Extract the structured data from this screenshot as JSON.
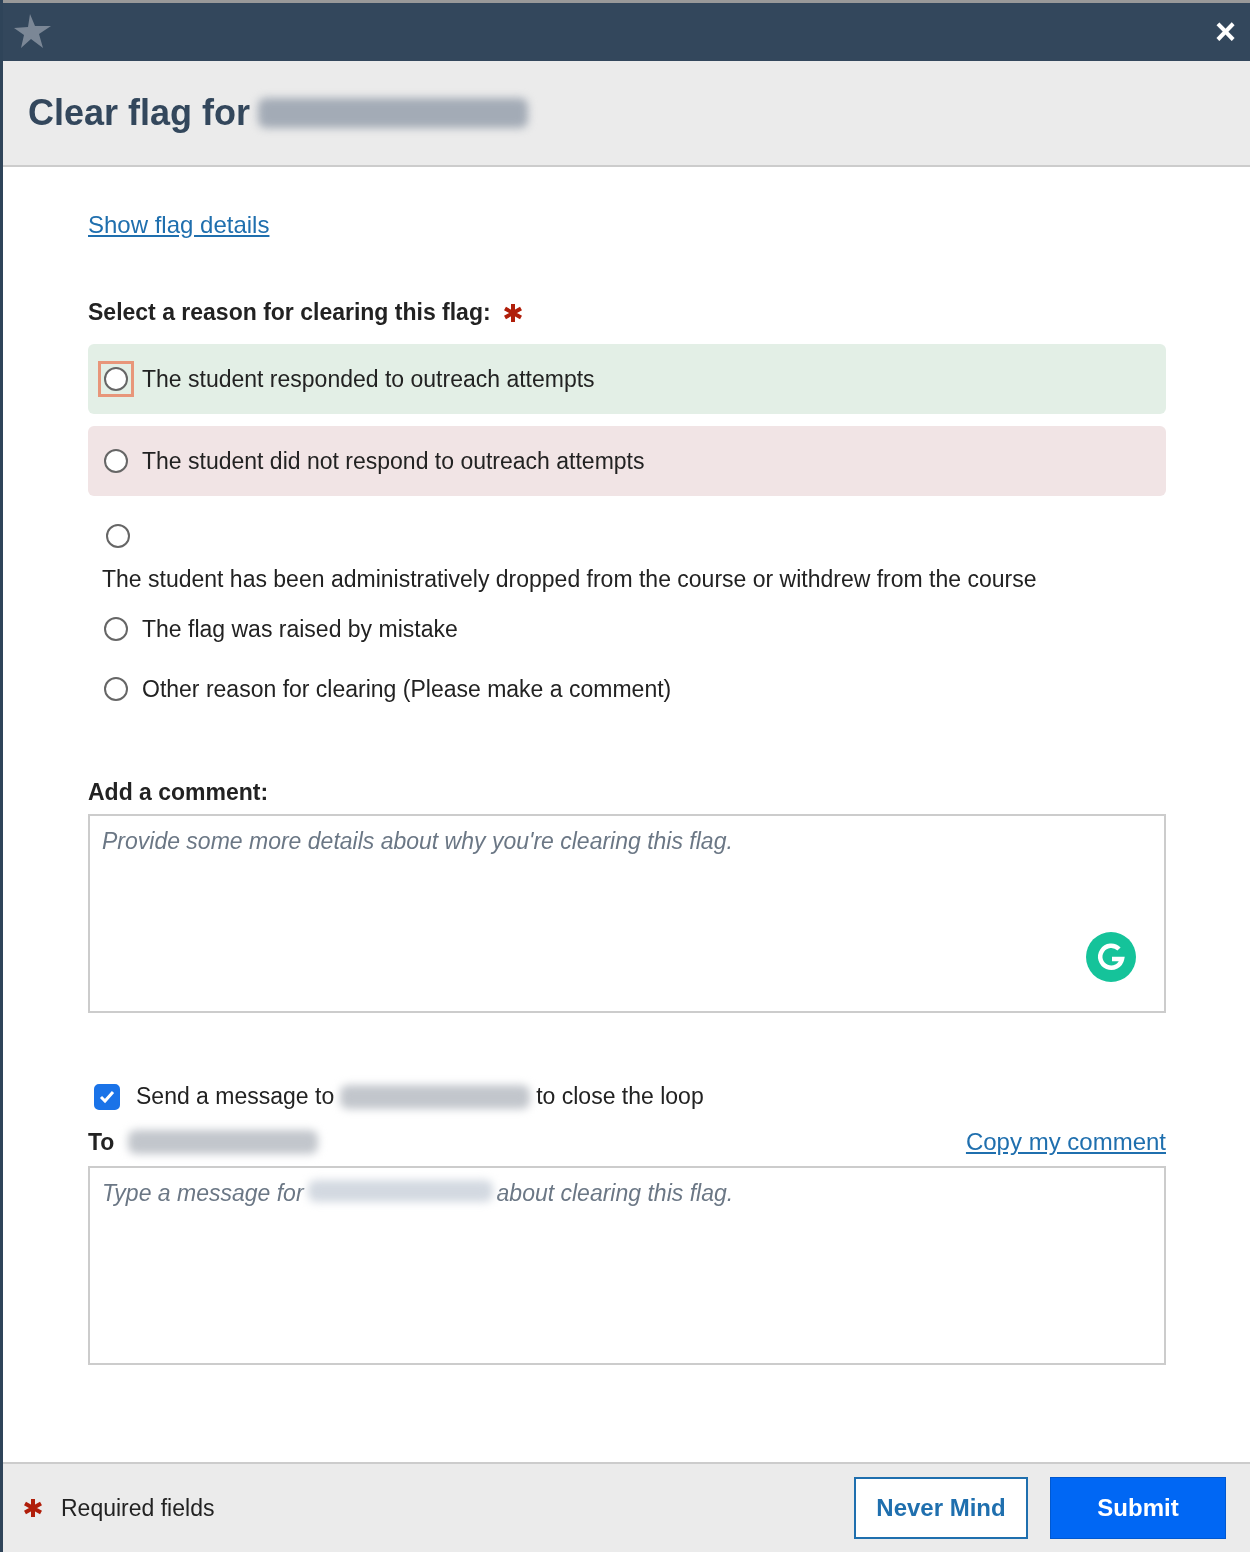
{
  "window": {
    "close": "×"
  },
  "title": {
    "text": "Clear flag for",
    "name_redacted": true
  },
  "details_link": "Show flag details",
  "reason": {
    "label": "Select a reason for clearing this flag:",
    "required": true,
    "options": [
      {
        "label": "The student responded to outreach attempts",
        "kind": "positive",
        "selected": false,
        "focused": true
      },
      {
        "label": "The student did not respond to outreach attempts",
        "kind": "negative",
        "selected": false,
        "focused": false
      },
      {
        "label": "The student has been administratively dropped from the course or withdrew from the course",
        "kind": "stacked",
        "selected": false,
        "focused": false
      },
      {
        "label": "The flag was raised by mistake",
        "kind": "plain",
        "selected": false,
        "focused": false
      },
      {
        "label": "Other reason for clearing (Please make a comment)",
        "kind": "plain",
        "selected": false,
        "focused": false
      }
    ]
  },
  "comment": {
    "label": "Add a comment:",
    "placeholder": "Provide some more details about why you're clearing this flag."
  },
  "message": {
    "checked": true,
    "before": "Send a message to",
    "after": "to close the loop",
    "to_label": "To",
    "copy_link": "Copy my comment",
    "placeholder_before": "Type a message for",
    "placeholder_after": "about clearing this flag."
  },
  "footer": {
    "required_text": "Required fields",
    "buttons": [
      {
        "label": "Never Mind",
        "kind": "secondary"
      },
      {
        "label": "Submit",
        "kind": "primary"
      }
    ]
  }
}
